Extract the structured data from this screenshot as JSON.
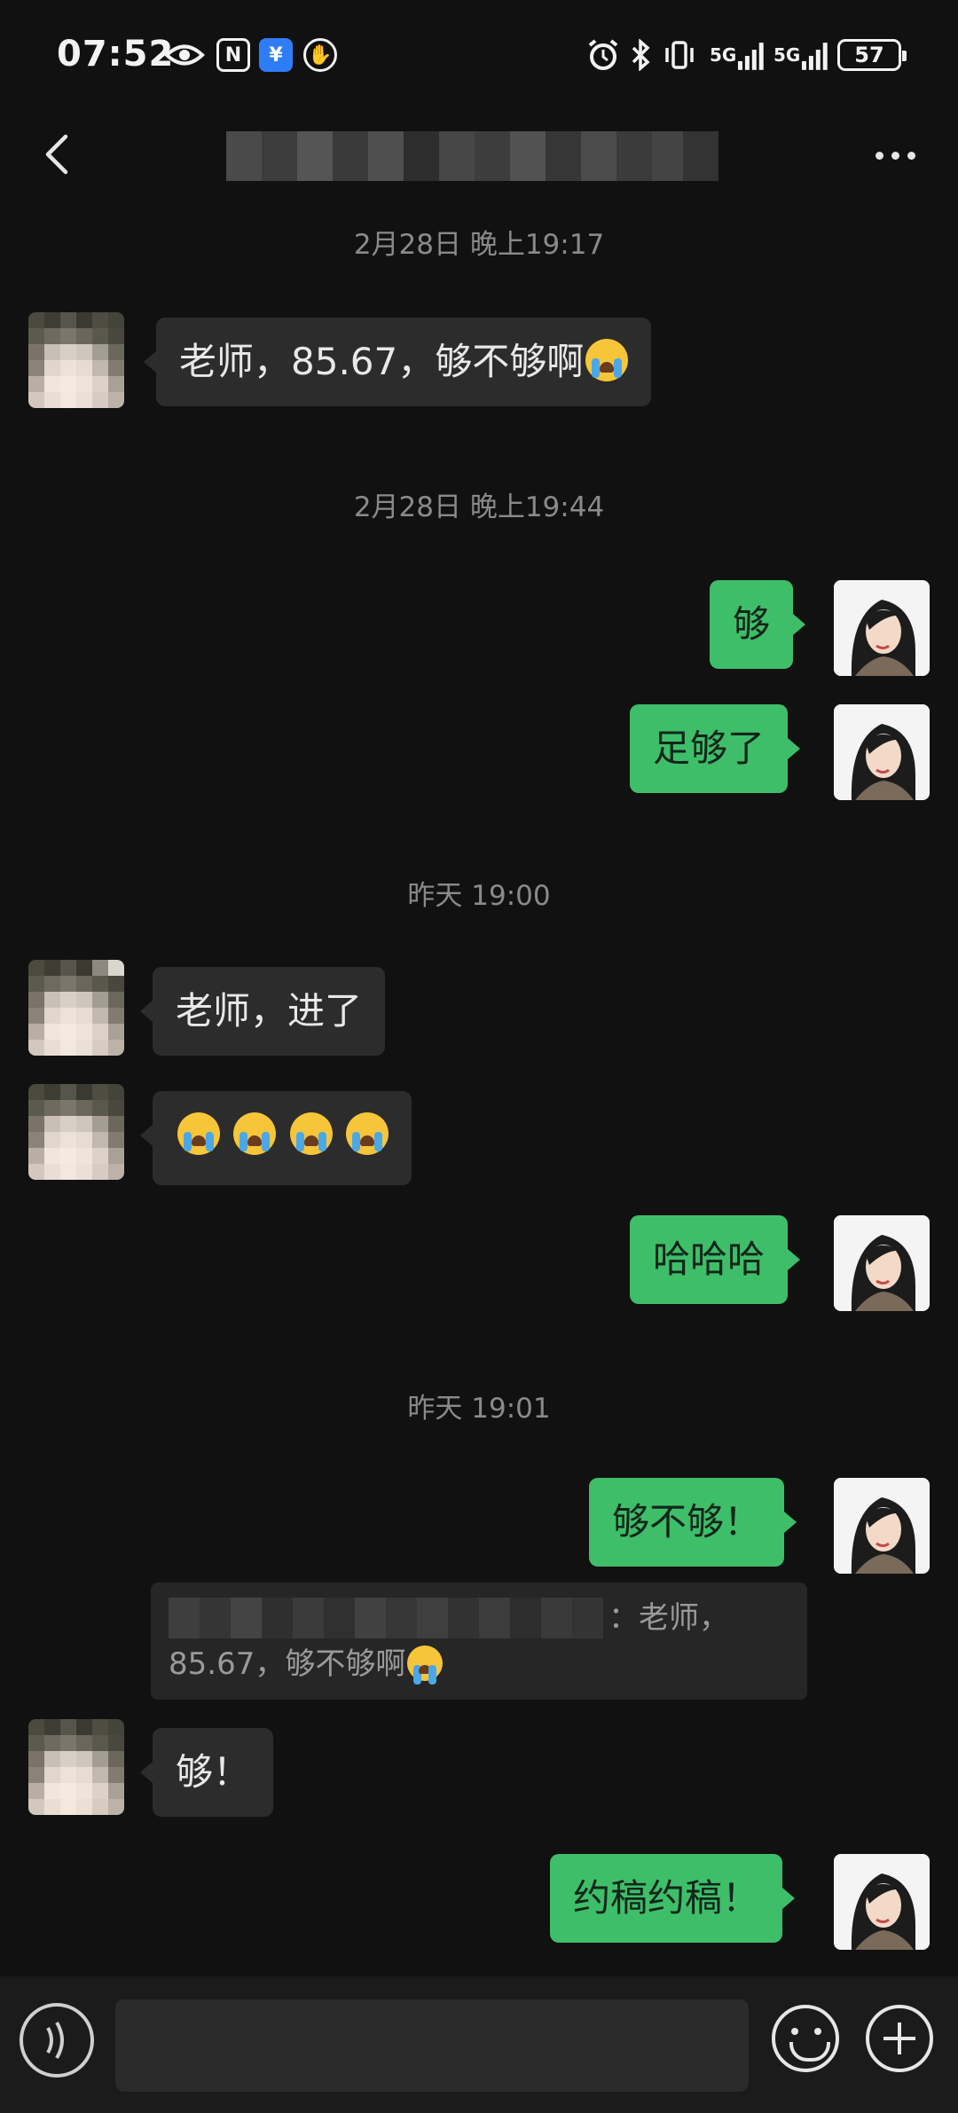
{
  "status_bar": {
    "time": "07:52",
    "network_label_1": "5G",
    "network_label_2": "5G",
    "battery": "57",
    "icons": [
      "eye-icon",
      "nfc-icon",
      "wallet-icon",
      "hand-icon",
      "alarm-icon",
      "bluetooth-icon",
      "vibrate-icon",
      "signal-icon",
      "signal-icon",
      "battery-icon"
    ]
  },
  "header": {
    "back_icon": "chevron-left-icon",
    "more_icon": "more-icon"
  },
  "timestamps": [
    "2月28日 晚上19:17",
    "2月28日 晚上19:44",
    "昨天 19:00",
    "昨天 19:01"
  ],
  "messages": [
    {
      "side": "in",
      "text": "老师，85.67，够不够啊",
      "emoji": "loudly-crying-face"
    },
    {
      "side": "out",
      "text": "够"
    },
    {
      "side": "out",
      "text": "足够了"
    },
    {
      "side": "in",
      "text": "老师，进了"
    },
    {
      "side": "in",
      "text": "",
      "emoji": "loudly-crying-face x4"
    },
    {
      "side": "out",
      "text": "哈哈哈"
    },
    {
      "side": "out",
      "text": "够不够！"
    },
    {
      "side": "in",
      "text": "够！"
    },
    {
      "side": "out",
      "text": "约稿约稿！"
    }
  ],
  "quote": {
    "line1_tail": "：老师，",
    "line2": "85.67，够不够啊"
  },
  "input_bar": {
    "placeholder": "",
    "icons": [
      "voice-icon",
      "emoji-icon",
      "plus-icon"
    ]
  },
  "colors": {
    "background": "#111111",
    "bubble_out": "#3fbe6a",
    "bubble_in": "#2c2c2c"
  }
}
